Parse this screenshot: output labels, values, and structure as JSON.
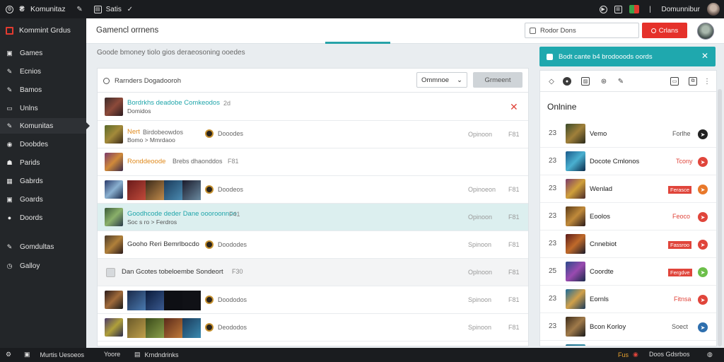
{
  "topbar": {
    "app_name": "Komunitaz",
    "nav_label": "Satis",
    "user_name": "Domunnibur"
  },
  "sidebar": {
    "title": "Kommint Grdus",
    "items": [
      {
        "label": "Games",
        "icon": "game-icon"
      },
      {
        "label": "Ecnios",
        "icon": "wrench-icon"
      },
      {
        "label": "Bamos",
        "icon": "hammer-icon"
      },
      {
        "label": "Unlns",
        "icon": "list-icon"
      },
      {
        "label": "Komunitas",
        "icon": "tool-icon",
        "active": true
      },
      {
        "label": "Doobdes",
        "icon": "disc-icon"
      },
      {
        "label": "Parids",
        "icon": "people-icon"
      },
      {
        "label": "Gabrds",
        "icon": "grid-icon"
      },
      {
        "label": "Goards",
        "icon": "box-icon"
      },
      {
        "label": "Doords",
        "icon": "circle-icon"
      },
      {
        "label": "Gomdultas",
        "icon": "pin-icon"
      },
      {
        "label": "Galloy",
        "icon": "clock-icon"
      }
    ]
  },
  "header": {
    "title": "Gamencl orrnens",
    "search_placeholder": "Rodor Dons",
    "action_button": "Crlans"
  },
  "subtitle": "Goode bmoney tiolo gios deraeosoning ooedes",
  "filter": {
    "search_placeholder": "Rarnders Dogadooroh",
    "dropdown": "Ommnoe",
    "button": "Grmeent"
  },
  "rows": [
    {
      "name": "Bordrkhs deadobe Comkeodos",
      "time": "2d",
      "sub": "Domidos"
    },
    {
      "name": "Nert",
      "mid": "Birdobeowdos",
      "sub": "Bomo > Mmrdaoo",
      "dot_label": "Dooodes",
      "c1": "Opinoon",
      "c2": "F81"
    },
    {
      "name": "Ronddeoode",
      "mid": "Brebs dhaonddos",
      "time": "F81"
    },
    {
      "dot_label": "Doodeos",
      "c1": "Opinoeon",
      "c2": "F81"
    },
    {
      "name": "Goodhcode deder Dane oooroonnoo",
      "time": "F41",
      "sub": "Soc s ro > Ferdros",
      "c1": "Opinoon",
      "c2": "F81"
    },
    {
      "name": "Gooho Reri Bemrlbocdo",
      "dot_label": "Doododes",
      "c1": "Spinoon",
      "c2": "F81"
    },
    {
      "name": "Dan Gcotes tobeloembe Sondeort",
      "time": "F30",
      "c1": "Oplnoon",
      "c2": "F81"
    },
    {
      "dot_label": "Doododos",
      "c1": "Spinoon",
      "c2": "F81"
    },
    {
      "dot_label": "Deododos",
      "c1": "Spinoon",
      "c2": "F81"
    }
  ],
  "notice": {
    "text": "Bodt cante b4 brodooods oords"
  },
  "online": {
    "heading": "Onlnine",
    "items": [
      {
        "rank": "23",
        "name": "Vemo",
        "tag": "Forlhe",
        "tag_style": "gray",
        "icon_color": "#222"
      },
      {
        "rank": "23",
        "name": "Docote Cmlonos",
        "tag": "Tcony",
        "tag_style": "red",
        "icon_color": "#e0453b"
      },
      {
        "rank": "23",
        "name": "Wenlad",
        "tag": "Ferasce",
        "tag_style": "badge",
        "icon_color": "#e8782a"
      },
      {
        "rank": "23",
        "name": "Eoolos",
        "tag": "Feoco",
        "tag_style": "red",
        "icon_color": "#e0453b"
      },
      {
        "rank": "23",
        "name": "Cnnebiot",
        "tag": "Fassroo",
        "tag_style": "badge",
        "icon_color": "#e0453b"
      },
      {
        "rank": "25",
        "name": "Coordte",
        "tag": "Fergdve",
        "tag_style": "badge",
        "icon_color": "#6cbf4a"
      },
      {
        "rank": "23",
        "name": "Eornls",
        "tag": "Fitnsa",
        "tag_style": "red",
        "icon_color": "#e0453b"
      },
      {
        "rank": "23",
        "name": "Bcon Korloy",
        "tag": "Soect",
        "tag_style": "gray",
        "icon_color": "#2e6fae"
      }
    ]
  },
  "bottombar": {
    "items": [
      "Murtis Uesoeos",
      "Yoore",
      "Krndndrinks"
    ],
    "status": "Fus",
    "status2": "Doos Gdsrbos"
  },
  "colors": {
    "accent": "#1fa8ae",
    "danger": "#e5312a",
    "sidebar_bg": "#232629"
  }
}
